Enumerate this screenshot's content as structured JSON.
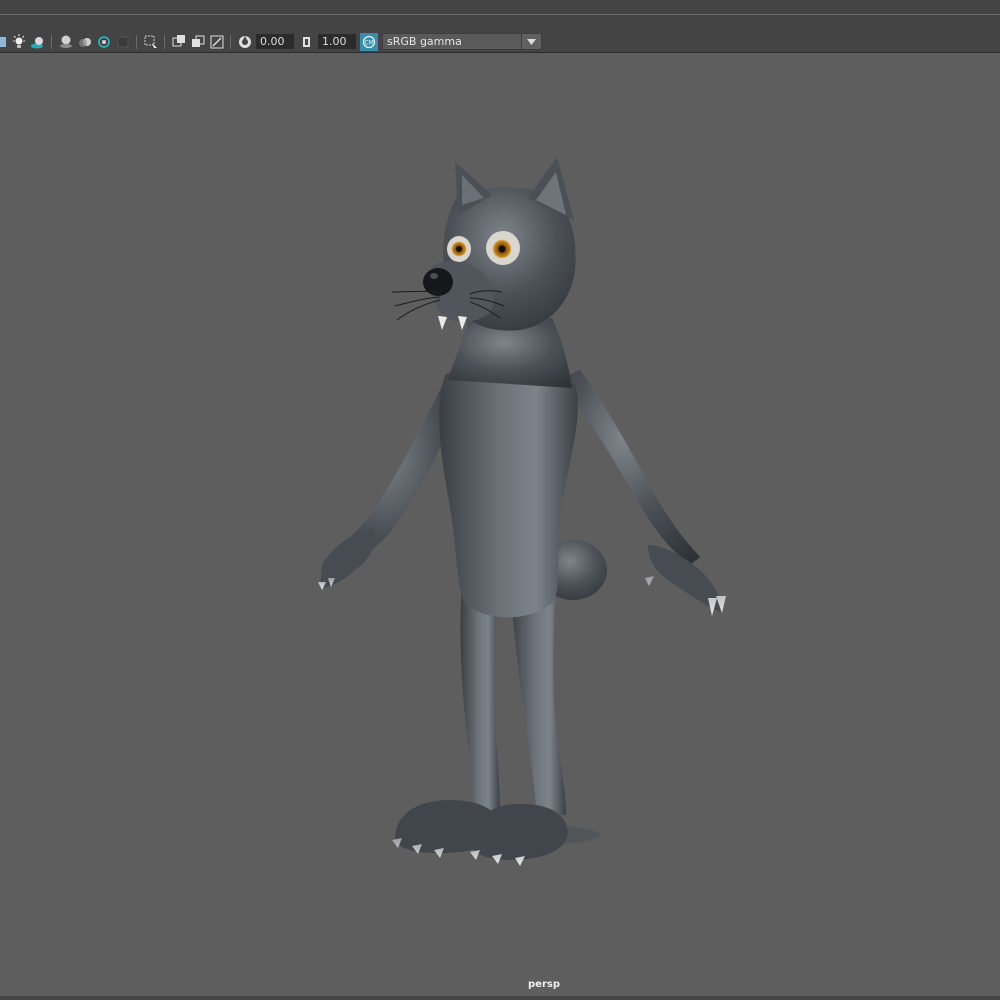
{
  "toolbar": {
    "exposure_value": "0.00",
    "gamma_value": "1.00",
    "color_space": "sRGB gamma",
    "icons": [
      "lights-icon",
      "default-light-icon",
      "shadows-icon",
      "ambient-occlusion-icon",
      "motion-blur-icon",
      "antialias-icon",
      "depth-of-field-icon",
      "isolate-select-icon",
      "xray-icon",
      "xray-active-icon",
      "xray-joints-icon",
      "resolution-gate-icon",
      "exposure-icon",
      "gamma-icon",
      "color-management-icon",
      "dropdown-arrow-icon"
    ]
  },
  "viewport": {
    "camera": "persp",
    "background_color": "#5e5e5e",
    "model": "cartoon-wolf"
  }
}
